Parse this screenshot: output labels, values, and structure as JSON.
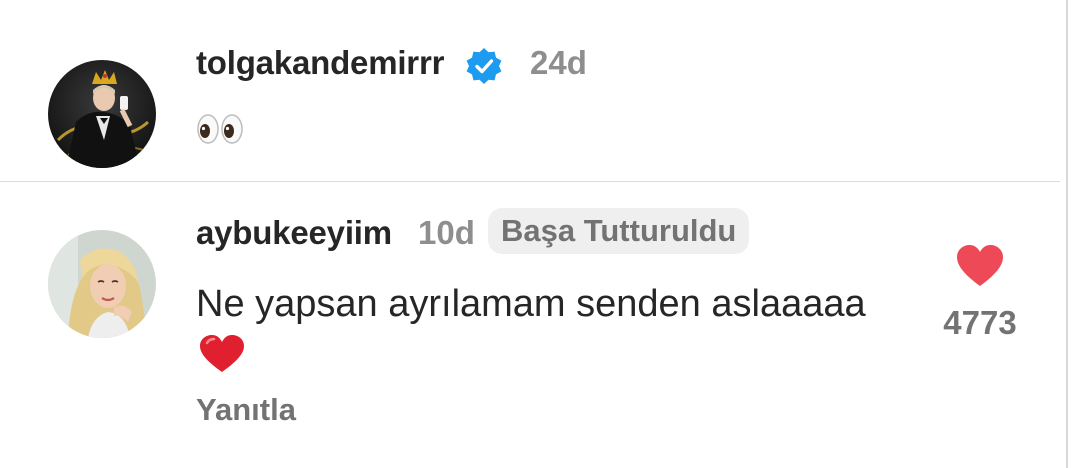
{
  "caption": {
    "username": "tolgakandemirrr",
    "verified_icon": "verified-badge-icon",
    "time": "24d",
    "text_emoji": "eyes-emoji"
  },
  "comment": {
    "username": "aybukeeyiim",
    "time": "10d",
    "pinned_label": "Başa Tutturuldu",
    "text": "Ne yapsan ayrılamam senden aslaaaaa",
    "text_emoji": "red-heart-emoji",
    "reply_label": "Yanıtla",
    "like_icon": "heart-icon",
    "like_count": "4773"
  },
  "colors": {
    "text": "#262626",
    "secondary": "#8e8e8e",
    "muted": "#737373",
    "verified": "#1d9bf0",
    "like": "#ed4956",
    "badge_bg": "#efefef"
  }
}
